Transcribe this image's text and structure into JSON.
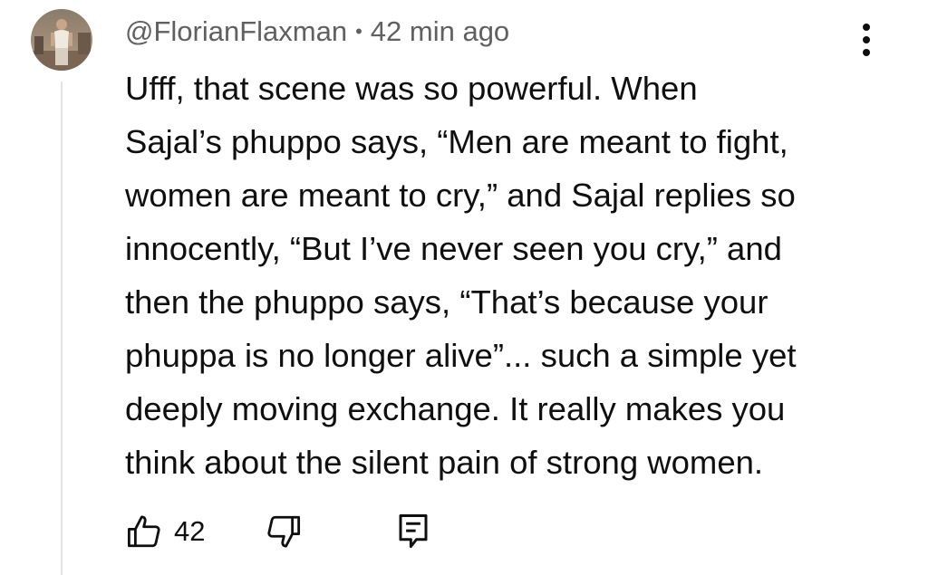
{
  "comment": {
    "author": "@FlorianFlaxman",
    "separator": "•",
    "timestamp": "42 min ago",
    "text_lines": [
      "Ufff, that scene was so powerful. When",
      "Sajal’s phuppo says, “Men are meant to fight,",
      "women are meant to cry,” and Sajal replies so",
      "innocently, “But I’ve never seen you cry,” and",
      "then the phuppo says, “That’s because your",
      "phuppa is no longer alive”... such a simple yet",
      "deeply moving exchange. It really makes you",
      "think about the silent pain of strong women."
    ],
    "likes": "42"
  },
  "icons": {
    "avatar": "user-avatar-photo",
    "more": "vertical-ellipsis-icon",
    "like": "thumbs-up-icon",
    "dislike": "thumbs-down-icon",
    "reply": "comment-reply-icon"
  },
  "colors": {
    "text": "#0f0f0f",
    "meta_text": "#606060",
    "thread_line": "#e3e3e3",
    "background": "#ffffff"
  }
}
